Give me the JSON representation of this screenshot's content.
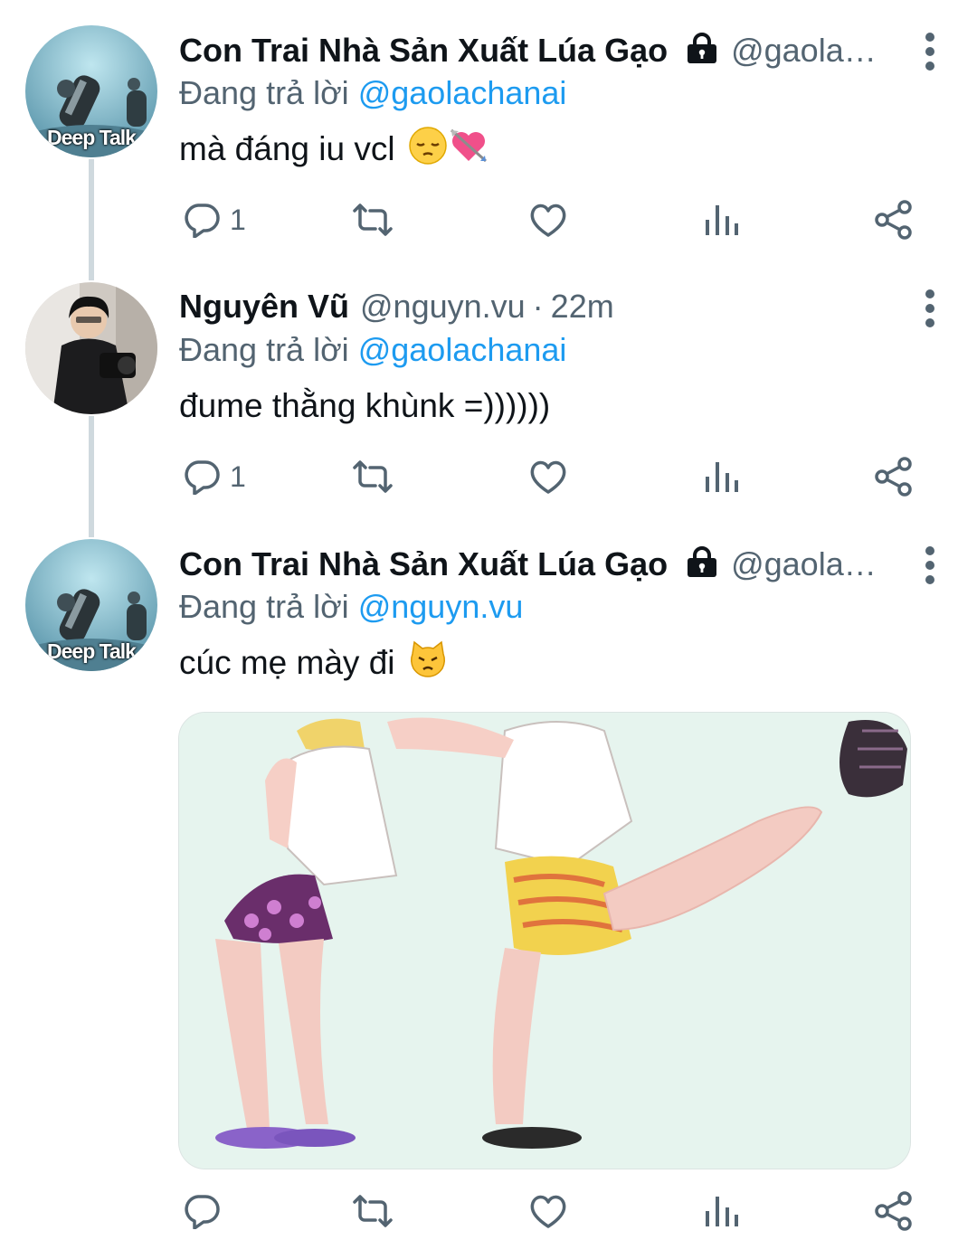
{
  "thread": [
    {
      "author": {
        "name": "Con Trai Nhà Sản Xuất Lúa Gạo",
        "handle": "@gaola…",
        "locked": true
      },
      "avatar": {
        "caption": "Deep Talk",
        "icon": "avatar-diver-icon"
      },
      "reply_prefix": "Đang trả lời",
      "reply_to": "@gaolachanai",
      "text": "mà đáng iu vcl",
      "emojis": [
        "😔",
        "💘"
      ],
      "stats": {
        "replies": "1"
      }
    },
    {
      "author": {
        "name": "Nguyên Vũ",
        "handle": "@nguyn.vu",
        "separator": "·",
        "time": "22m"
      },
      "avatar": {
        "icon": "avatar-photographer-icon"
      },
      "reply_prefix": "Đang trả lời",
      "reply_to": "@gaolachanai",
      "text": "đume thằng khùnk =))))))",
      "stats": {
        "replies": "1"
      }
    },
    {
      "author": {
        "name": "Con Trai Nhà Sản Xuất Lúa Gạo",
        "handle": "@gaola…",
        "locked": true
      },
      "avatar": {
        "caption": "Deep Talk",
        "icon": "avatar-diver-icon"
      },
      "reply_prefix": "Đang trả lời",
      "reply_to": "@nguyn.vu",
      "text": "cúc mẹ mày đi",
      "emojis": [
        "😾"
      ],
      "media": {
        "type": "image",
        "icon": "anime-kick-illustration"
      }
    }
  ],
  "icons": [
    "reply-icon",
    "retweet-icon",
    "like-icon",
    "analytics-icon",
    "share-icon",
    "lock-icon",
    "more-icon"
  ],
  "colors": {
    "text": "#0f1419",
    "secondary": "#536471",
    "link": "#1d9bf0",
    "thread_line": "#cfd9de"
  }
}
